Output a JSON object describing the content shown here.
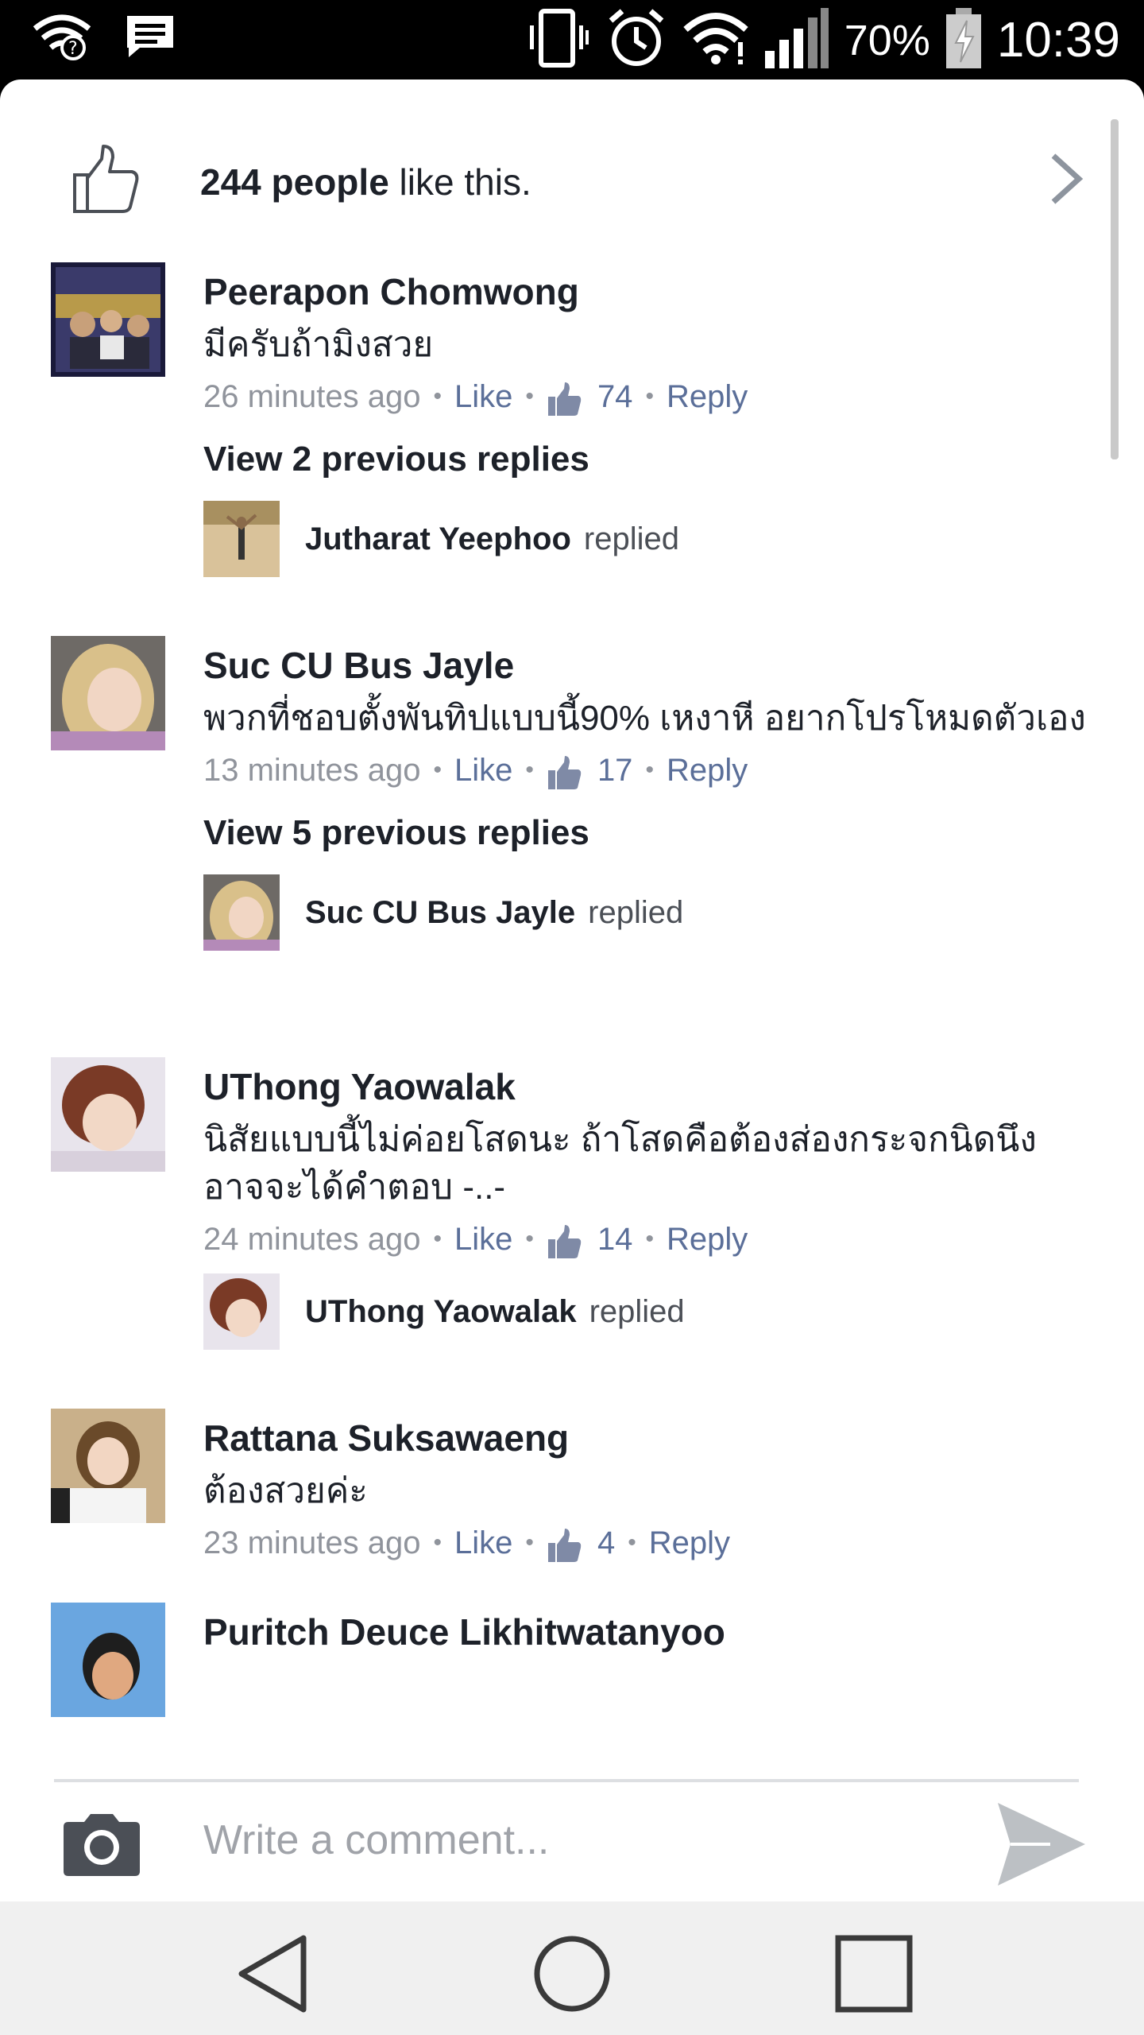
{
  "status_bar": {
    "battery_percent": "70%",
    "time": "10:39",
    "icons": [
      "wifi-question-icon",
      "message-icon",
      "vibrate-icon",
      "alarm-icon",
      "wifi-icon",
      "signal-icon",
      "battery-charging-icon"
    ]
  },
  "likes": {
    "count_text": "244 people",
    "suffix": " like this."
  },
  "comments": [
    {
      "name": "Peerapon Chomwong",
      "body": "มีครับถ้ามิงสวย",
      "time": "26 minutes ago",
      "like_label": "Like",
      "like_count": "74",
      "reply_label": "Reply",
      "view_previous": "View 2 previous replies",
      "reply_preview": {
        "name": "Jutharat Yeephoo",
        "verb": "replied"
      }
    },
    {
      "name": "Suc CU Bus Jayle",
      "body": "พวกที่ชอบตั้งพันทิปแบบนี้90% เหงาหี อยากโปรโหมดตัวเอง",
      "time": "13 minutes ago",
      "like_label": "Like",
      "like_count": "17",
      "reply_label": "Reply",
      "view_previous": "View 5 previous replies",
      "reply_preview": {
        "name": "Suc CU Bus Jayle",
        "verb": "replied"
      }
    },
    {
      "name": "UThong Yaowalak",
      "body": "นิสัยแบบนี้ไม่ค่อยโสดนะ ถ้าโสดคือต้องส่องกระจกนิดนึง อาจจะได้คำตอบ -..-",
      "time": "24 minutes ago",
      "like_label": "Like",
      "like_count": "14",
      "reply_label": "Reply",
      "reply_preview": {
        "name": "UThong Yaowalak",
        "verb": "replied"
      }
    },
    {
      "name": "Rattana Suksawaeng",
      "body": "ต้องสวยค่ะ",
      "time": "23 minutes ago",
      "like_label": "Like",
      "like_count": "4",
      "reply_label": "Reply"
    },
    {
      "name": "Puritch Deuce Likhitwatanyoo"
    }
  ],
  "composer": {
    "placeholder": "Write a comment..."
  },
  "colors": {
    "link": "#5b6f99",
    "meta_gray": "#90949c",
    "text": "#1d2129"
  }
}
